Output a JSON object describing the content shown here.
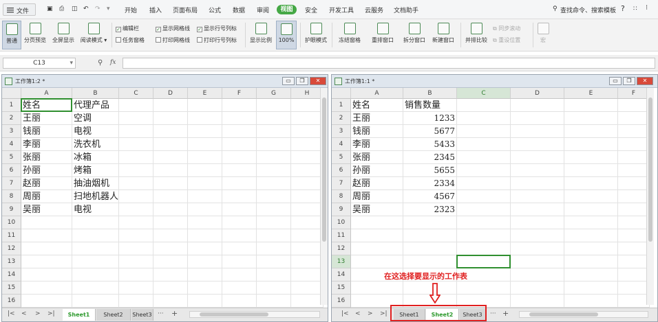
{
  "menubar": {
    "file_label": "文件",
    "tabs": [
      "开始",
      "插入",
      "页面布局",
      "公式",
      "数据",
      "审阅",
      "视图",
      "安全",
      "开发工具",
      "云服务",
      "文档助手"
    ],
    "active_tab": "视图",
    "search_label": "查找命令、搜索模板",
    "help": "?"
  },
  "ribbon": {
    "view_buttons": [
      "普通",
      "分页预览",
      "全屏显示",
      "阅读模式"
    ],
    "checks_col1": [
      {
        "label": "编辑栏",
        "checked": true
      },
      {
        "label": "任务窗格",
        "checked": false
      }
    ],
    "checks_col2": [
      {
        "label": "显示网格线",
        "checked": true
      },
      {
        "label": "打印网格线",
        "checked": false
      }
    ],
    "checks_col3": [
      {
        "label": "显示行号列标",
        "checked": true
      },
      {
        "label": "打印行号列标",
        "checked": false
      }
    ],
    "zoom_buttons": [
      "显示比例",
      "100%"
    ],
    "buttons": [
      "护眼模式",
      "冻结窗格",
      "重排窗口",
      "拆分窗口",
      "新建窗口",
      "并排比较"
    ],
    "sync_scroll": "同步滚动",
    "reset_pos": "重设位置",
    "macro": "宏"
  },
  "formulabar": {
    "cell_ref": "C13",
    "fx": "fx",
    "value": ""
  },
  "left_window": {
    "title": "工作簿1:2 *",
    "columns": [
      "A",
      "B",
      "C",
      "D",
      "E",
      "F",
      "G",
      "H"
    ],
    "rows": [
      "1",
      "2",
      "3",
      "4",
      "5",
      "6",
      "7",
      "8",
      "9",
      "10",
      "11",
      "12",
      "13",
      "14",
      "15",
      "16"
    ],
    "data": [
      [
        "姓名",
        "代理产品"
      ],
      [
        "王丽",
        "空调"
      ],
      [
        "钱丽",
        "电视"
      ],
      [
        "李丽",
        "洗衣机"
      ],
      [
        "张丽",
        "冰箱"
      ],
      [
        "孙丽",
        "烤箱"
      ],
      [
        "赵丽",
        "抽油烟机"
      ],
      [
        "周丽",
        "扫地机器人"
      ],
      [
        "吴丽",
        "电视"
      ]
    ],
    "sheets": [
      "Sheet1",
      "Sheet2",
      "Sheet3"
    ],
    "active_sheet": "Sheet1"
  },
  "right_window": {
    "title": "工作簿1:1 *",
    "columns": [
      "A",
      "B",
      "C",
      "D",
      "E",
      "F"
    ],
    "rows": [
      "1",
      "2",
      "3",
      "4",
      "5",
      "6",
      "7",
      "8",
      "9",
      "10",
      "11",
      "12",
      "13",
      "14",
      "15",
      "16"
    ],
    "data": [
      [
        "姓名",
        "销售数量"
      ],
      [
        "王丽",
        "1233"
      ],
      [
        "钱丽",
        "5677"
      ],
      [
        "李丽",
        "5433"
      ],
      [
        "张丽",
        "2345"
      ],
      [
        "孙丽",
        "5655"
      ],
      [
        "赵丽",
        "2334"
      ],
      [
        "周丽",
        "4567"
      ],
      [
        "吴丽",
        "2323"
      ]
    ],
    "sheets": [
      "Sheet1",
      "Sheet2",
      "Sheet3"
    ],
    "active_sheet": "Sheet2"
  },
  "annotation": {
    "text": "在这选择要显示的工作表",
    "color": "#e02020"
  },
  "colors": {
    "accent": "#45a845",
    "selection": "#2f8f2f"
  }
}
